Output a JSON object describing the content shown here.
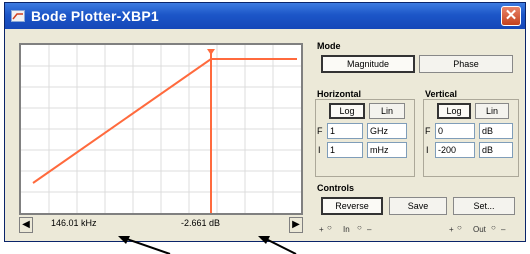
{
  "window": {
    "title": "Bode Plotter-XBP1"
  },
  "plot": {
    "line_color": "#ff6a3d",
    "cursor_color": "#ff6a3d",
    "grid_color": "#dcdcdc"
  },
  "readout": {
    "frequency": "146.01 kHz",
    "magnitude": "-2.661 dB"
  },
  "mode": {
    "label": "Mode",
    "magnitude_button": "Magnitude",
    "phase_button": "Phase"
  },
  "horizontal": {
    "label": "Horizontal",
    "log_button": "Log",
    "lin_button": "Lin",
    "f_label": "F",
    "f_value": "1",
    "f_unit": "GHz",
    "i_label": "I",
    "i_value": "1",
    "i_unit": "mHz"
  },
  "vertical": {
    "label": "Vertical",
    "log_button": "Log",
    "lin_button": "Lin",
    "f_label": "F",
    "f_value": "0",
    "f_unit": "dB",
    "i_label": "I",
    "i_value": "-200",
    "i_unit": "dB"
  },
  "controls": {
    "label": "Controls",
    "reverse_button": "Reverse",
    "save_button": "Save",
    "set_button": "Set..."
  },
  "terminals": {
    "in_plus": "+",
    "in_label": "In",
    "in_minus": "–",
    "out_plus": "+",
    "out_label": "Out",
    "out_minus": "–"
  }
}
